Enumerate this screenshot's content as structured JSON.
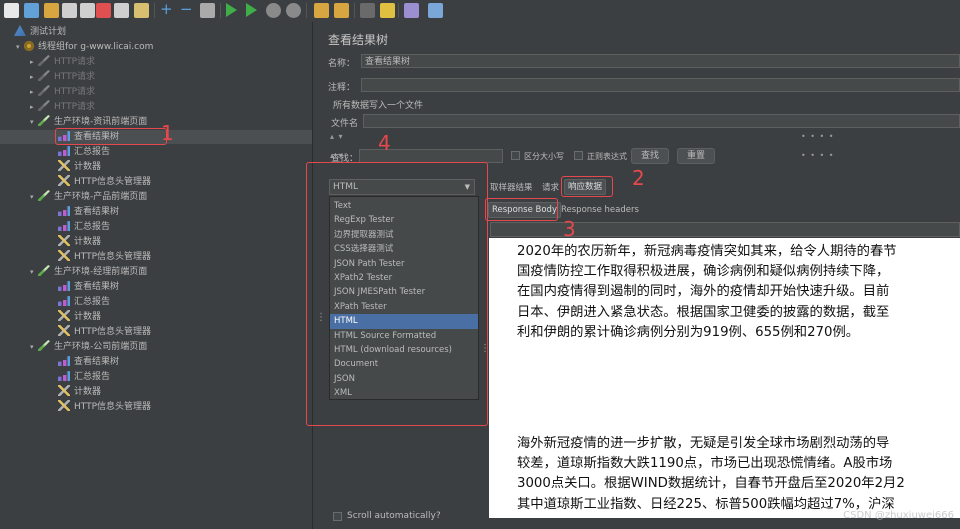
{
  "toolbar": {
    "buttons": [
      "new-icon",
      "templates-icon",
      "open-icon",
      "save-icon",
      "save-as-icon",
      "cut-icon",
      "copy-icon",
      "paste-icon",
      "expand-icon",
      "collapse-icon",
      "toggle-icon",
      "start-icon",
      "start-no-pause-icon",
      "stop-icon",
      "shutdown-icon",
      "clear-icon",
      "clear-all-icon",
      "search-icon",
      "reset-search-icon",
      "function-helper-icon",
      "help-icon"
    ]
  },
  "tree": {
    "root": "测试计划",
    "thread_group": "线程组for g-www.licai.com",
    "disabled_items": [
      "HTTP请求",
      "HTTP请求",
      "HTTP请求",
      "HTTP请求"
    ],
    "groups": [
      {
        "label": "生产环境-资讯前端页面",
        "children": [
          "查看结果树",
          "汇总报告",
          "计数器",
          "HTTP信息头管理器"
        ]
      },
      {
        "label": "生产环境-产品前端页面",
        "children": [
          "查看结果树",
          "汇总报告",
          "计数器",
          "HTTP信息头管理器"
        ]
      },
      {
        "label": "生产环境-经理前端页面",
        "children": [
          "查看结果树",
          "汇总报告",
          "计数器",
          "HTTP信息头管理器"
        ]
      },
      {
        "label": "生产环境-公司前端页面",
        "children": [
          "查看结果树",
          "汇总报告",
          "计数器",
          "HTTP信息头管理器"
        ]
      }
    ]
  },
  "panel": {
    "title": "查看结果树",
    "name_label": "名称：",
    "name_value": "查看结果树",
    "comment_label": "注释：",
    "comment_value": "",
    "write_all_label": "所有数据写入一个文件",
    "filename_label": "文件名",
    "filename_value": "",
    "search_label": "查找：",
    "search_value": "",
    "case_sensitive_label": "区分大小写",
    "regex_label": "正则表达式",
    "search_button": "查找",
    "reset_button": "重置",
    "renderer_selected": "HTML",
    "renderer_options": [
      "Text",
      "RegExp Tester",
      "边界提取器测试",
      "CSS选择器测试",
      "JSON Path Tester",
      "XPath2 Tester",
      "JSON JMESPath Tester",
      "XPath Tester",
      "HTML",
      "HTML Source Formatted",
      "HTML (download resources)",
      "Document",
      "JSON",
      "XML"
    ],
    "tabs": [
      "取样器结果",
      "请求",
      "响应数据"
    ],
    "subtabs": [
      "Response Body",
      "Response headers"
    ],
    "scroll_auto_label": "Scroll automatically?"
  },
  "content": {
    "paragraph1": [
      "2020年的农历新年，新冠病毒疫情突如其来，给令人期待的春节",
      "国疫情防控工作取得积极进展，确诊病例和疑似病例持续下降，",
      "在国内疫情得到遏制的同时，海外的疫情却开始快速升级。目前",
      "日本、伊朗进入紧急状态。根据国家卫健委的披露的数据，截至",
      "利和伊朗的累计确诊病例分别为919例、655例和270例。"
    ],
    "paragraph2": [
      "海外新冠疫情的进一步扩散，无疑是引发全球市场剧烈动荡的导",
      "较差，道琼斯指数大跌1190点，市场已出现恐慌情绪。A股市场",
      "3000点关口。根据WIND数据统计，自春节开盘后至2020年2月2",
      "其中道琼斯工业指数、日经225、标普500跌幅均超过7%，沪深"
    ]
  },
  "annotations": [
    "1",
    "2",
    "3",
    "4"
  ],
  "watermark": "CSDN @zhuxiuwei666",
  "colors": {
    "selection": "#4a6fa5",
    "annotation": "#e5484d"
  }
}
